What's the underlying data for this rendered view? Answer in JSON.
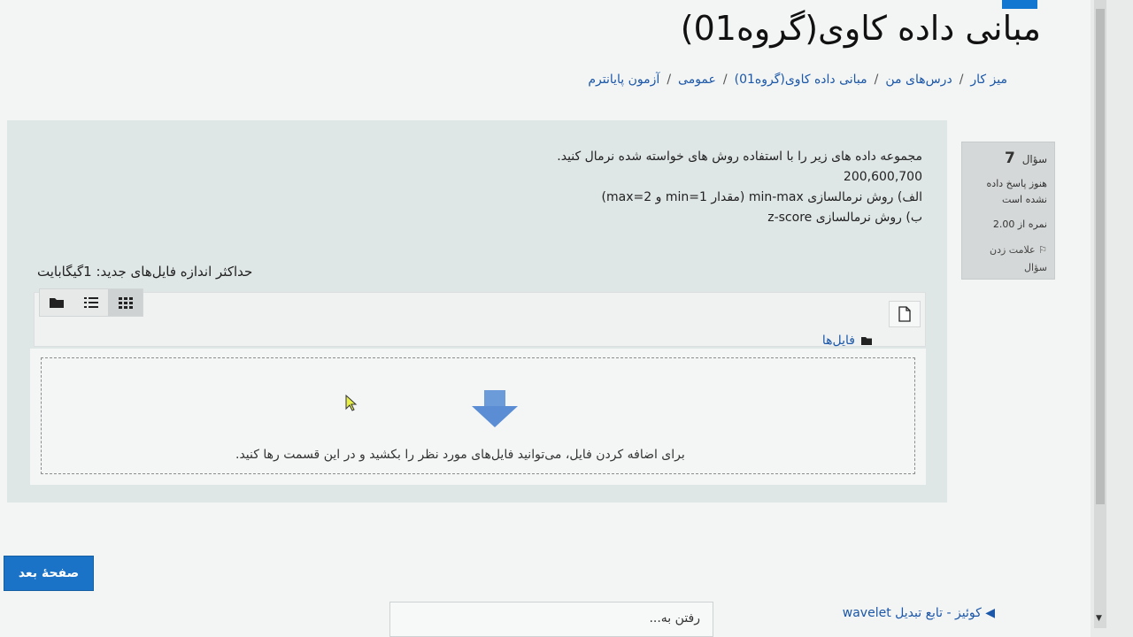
{
  "course": {
    "title": "مبانی داده کاوی(گروه01)"
  },
  "breadcrumb": {
    "items": [
      "میز کار",
      "درس‌های من",
      "مبانی داده کاوی(گروه01)",
      "عمومی",
      "آزمون پایانترم"
    ],
    "separator": "/"
  },
  "question_info": {
    "label": "سؤال",
    "number": "7",
    "status": "هنوز پاسخ داده نشده است",
    "grade": "نمره از 2.00",
    "flag_label": "علامت زدن سؤال"
  },
  "question": {
    "lines": [
      "مجموعه داده های زیر را با استفاده روش های خواسته شده نرمال کنید.",
      "200,600,700",
      "الف) روش نرمالسازی min-max (مقدار min=1 و max=2)",
      "ب) روش نرمالسازی z-score"
    ]
  },
  "file_picker": {
    "max_size": "حداکثر اندازه فایل‌های جدید: 1گیگابایت",
    "path_label": "فایل‌ها",
    "drop_hint": "برای اضافه کردن فایل، می‌توانید فایل‌های مورد نظر را بکشید و در این قسمت رها کنید.",
    "view_icons": [
      "folder-icon",
      "list-icon",
      "grid-icon"
    ]
  },
  "navigation": {
    "next_button": "صفحهٔ بعد",
    "jump_placeholder": "رفتن به...",
    "prev_link": "◀ کوئیز - تابع تبدیل wavelet"
  },
  "colors": {
    "accent": "#1a73c6",
    "link": "#1a57a8",
    "question_bg": "#dfe6e6",
    "arrow": "#6b9bd8"
  }
}
